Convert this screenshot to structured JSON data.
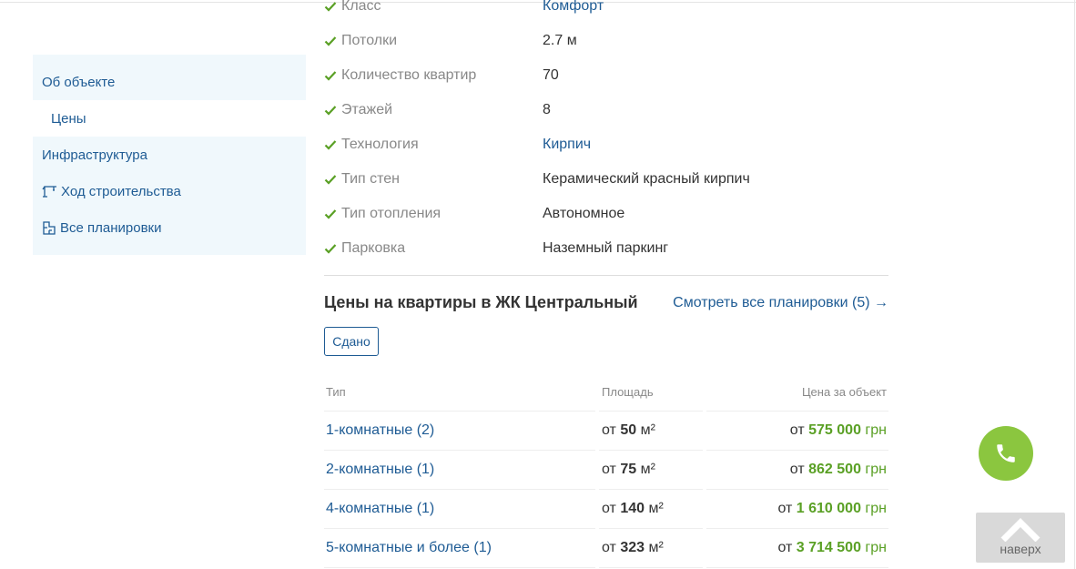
{
  "sidebar": {
    "items": [
      {
        "label": "Об объекте"
      },
      {
        "label": "Цены"
      },
      {
        "label": "Инфраструктура"
      },
      {
        "label": "Ход строительства"
      },
      {
        "label": "Все планировки"
      }
    ]
  },
  "specs": [
    {
      "label": "Класс",
      "value": "Комфорт"
    },
    {
      "label": "Потолки",
      "value": "2.7 м"
    },
    {
      "label": "Количество квартир",
      "value": "70"
    },
    {
      "label": "Этажей",
      "value": "8"
    },
    {
      "label": "Технология",
      "value": "Кирпич"
    },
    {
      "label": "Тип стен",
      "value": "Керамический красный кирпич"
    },
    {
      "label": "Тип отопления",
      "value": "Автономное"
    },
    {
      "label": "Парковка",
      "value": "Наземный паркинг"
    }
  ],
  "prices": {
    "title": "Цены на квартиры в ЖК Центральный",
    "all_layouts_link": "Смотреть все планировки (5) →",
    "status_button": "Сдано",
    "headers": {
      "type": "Тип",
      "area": "Площадь",
      "price": "Цена за объект"
    },
    "rows": [
      {
        "type": "1-комнатные (2)",
        "area_prefix": "от",
        "area": "50",
        "area_unit": "м²",
        "price_prefix": "от",
        "price": "575 000",
        "currency": "грн"
      },
      {
        "type": "2-комнатные (1)",
        "area_prefix": "от",
        "area": "75",
        "area_unit": "м²",
        "price_prefix": "от",
        "price": "862 500",
        "currency": "грн"
      },
      {
        "type": "4-комнатные (1)",
        "area_prefix": "от",
        "area": "140",
        "area_unit": "м²",
        "price_prefix": "от",
        "price": "1 610 000",
        "currency": "грн"
      },
      {
        "type": "5-комнатные и более (1)",
        "area_prefix": "от",
        "area": "323",
        "area_unit": "м²",
        "price_prefix": "от",
        "price": "3 714 500",
        "currency": "грн"
      }
    ]
  },
  "floating": {
    "up_label": "наверх"
  },
  "colors": {
    "link": "#1e5b94",
    "price_green": "#5aa025",
    "call_button": "#8bc63f",
    "check_green": "#5aa025"
  }
}
